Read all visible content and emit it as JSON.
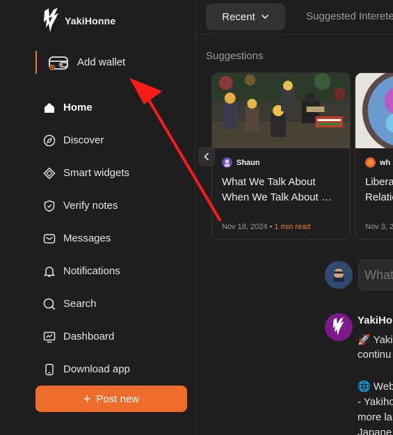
{
  "app": {
    "logo_text": "YakiHonne"
  },
  "sidebar": {
    "add_wallet_label": "Add wallet",
    "items": [
      {
        "label": "Home",
        "icon": "home-icon"
      },
      {
        "label": "Discover",
        "icon": "discover-icon"
      },
      {
        "label": "Smart widgets",
        "icon": "smart-widgets-icon"
      },
      {
        "label": "Verify notes",
        "icon": "verify-icon"
      },
      {
        "label": "Messages",
        "icon": "messages-icon"
      },
      {
        "label": "Notifications",
        "icon": "bell-icon"
      },
      {
        "label": "Search",
        "icon": "search-icon"
      },
      {
        "label": "Dashboard",
        "icon": "dashboard-icon"
      },
      {
        "label": "Download app",
        "icon": "phone-icon"
      }
    ],
    "post_new_label": "Post new"
  },
  "topbar": {
    "recent_label": "Recent",
    "suggested_label": "Suggested Intereted"
  },
  "suggestions": {
    "title": "Suggestions",
    "cards": [
      {
        "author": "Shaun",
        "title_line1": "What We Talk About",
        "title_line2": "When We Talk About …",
        "date": "Nov 18, 2024",
        "separator": "•",
        "read": "1 min read"
      },
      {
        "author": "wh",
        "title_line1": "Libera",
        "title_line2": "Relatio",
        "date": "Nov 3, 2",
        "separator": "",
        "read": ""
      }
    ]
  },
  "compose": {
    "placeholder": "What"
  },
  "feed": {
    "author": "YakiHo",
    "lines": [
      "🚀 Yaki",
      "continu",
      "",
      "🌐 Web",
      "- Yakiho",
      "more la",
      "Japane"
    ]
  },
  "colors": {
    "accent": "#ee6d2b",
    "background": "#1e1e1e",
    "annotation_arrow": "#ff1a1a"
  }
}
